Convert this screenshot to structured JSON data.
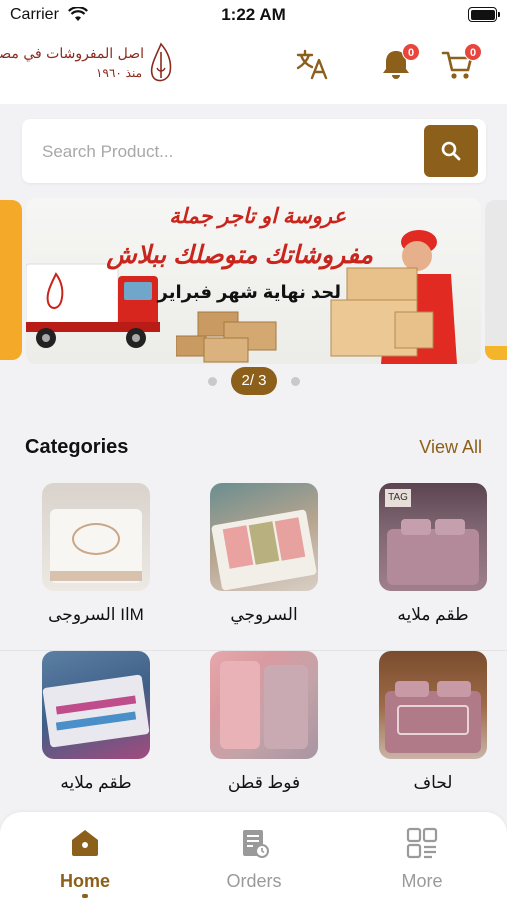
{
  "status": {
    "carrier": "Carrier",
    "time": "1:22 AM"
  },
  "header": {
    "logo_line1": "اصل المفروشات في مصر",
    "logo_line2": "منذ ١٩٦٠",
    "notifications_count": "0",
    "cart_count": "0"
  },
  "search": {
    "placeholder": "Search Product..."
  },
  "banner": {
    "line1": "عروسة او تاجر جملة",
    "line2": "مفروشاتك متوصلك ببلاش",
    "line3": "لحد نهاية شهر فبراير",
    "pager": "2/ 3"
  },
  "categories": {
    "title": "Categories",
    "view_all": "View All",
    "items": [
      {
        "label": "طقم ملايه"
      },
      {
        "label": "السروجي"
      },
      {
        "label": "MاI السروجى"
      },
      {
        "label": "لحاف"
      },
      {
        "label": "فوط قطن"
      },
      {
        "label": "طقم ملايه"
      }
    ]
  },
  "tabs": [
    {
      "label": "Home"
    },
    {
      "label": "Orders"
    },
    {
      "label": "More"
    }
  ],
  "colors": {
    "accent": "#8c5f1a",
    "badge": "#e8453c",
    "banner_red": "#c8251d"
  }
}
